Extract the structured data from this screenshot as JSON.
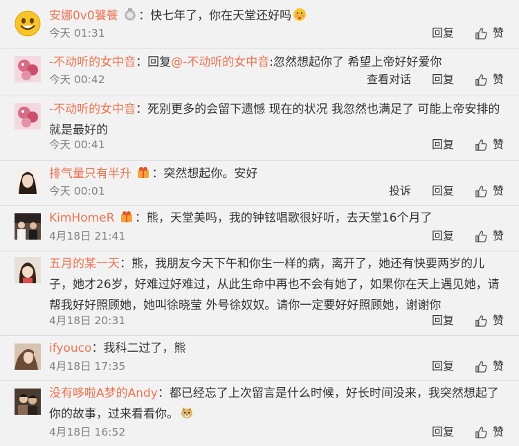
{
  "comments": [
    {
      "avatar": "yellow-smiley-avatar",
      "name": "安娜0v0饕餮",
      "badge": "medal-icon",
      "text": "：快七年了，你在天堂还好吗",
      "emoji": "blush-emoji",
      "time": "今天 01:31",
      "actions": [
        "回复",
        "赞"
      ]
    },
    {
      "avatar": "pink-cartoon-avatar",
      "name": "-不动听的女中音",
      "text_prefix": "：回复",
      "mention": "@-不动听的女中音",
      "text": ":忽然想起你了 希望上帝好好爱你",
      "time": "今天 00:42",
      "actions": [
        "查看对话",
        "回复",
        "赞"
      ]
    },
    {
      "avatar": "pink-cartoon-avatar",
      "name": "-不动听的女中音",
      "text": "：死别更多的会留下遗憾 现在的状况 我忽然也满足了 可能上帝安排的就是最好的",
      "time": "今天 00:41",
      "actions": [
        "回复",
        "赞"
      ]
    },
    {
      "avatar": "woman-photo-avatar",
      "name": "排气量只有半升",
      "badge": "gift-badge-icon",
      "text": "：突然想起你。安好",
      "time": "今天 00:01",
      "actions": [
        "投诉",
        "回复",
        "赞"
      ]
    },
    {
      "avatar": "group-photo-avatar",
      "name": "KimHomeR",
      "badge": "gift-badge-icon",
      "text": "：熊，天堂美吗，我的钟铉唱歌很好听，去天堂16个月了",
      "time": "4月18日 21:41",
      "actions": [
        "回复",
        "赞"
      ]
    },
    {
      "avatar": "anime-girl-avatar",
      "name": "五月的某一天",
      "text": "：熊，我朋友今天下午和你生一样的病，离开了，她还有快要两岁的儿子，她才26岁，好难过好难过，从此生命中再也不会有她了，如果你在天上遇见她，请帮我好好照顾她，她叫徐晓莹 外号徐奴奴。请你一定要好好照顾她，谢谢你",
      "time": "4月18日 20:31",
      "actions": [
        "回复",
        "赞"
      ]
    },
    {
      "avatar": "portrait-photo-avatar",
      "name": "ifyouco",
      "text": "：我科二过了，熊",
      "time": "4月18日 17:35",
      "actions": [
        "回复",
        "赞"
      ]
    },
    {
      "avatar": "couple-photo-avatar",
      "name": "没有哆啦A梦的Andy",
      "text": "：都已经忘了上次留言是什么时候，好长时间没来，我突然想起了你的故事，过来看看你。",
      "emoji": "doge-emoji",
      "time": "4月18日 16:52",
      "actions": [
        "回复",
        "赞"
      ]
    }
  ],
  "colors": {
    "name": "#eb7350",
    "text": "#333333",
    "meta": "#808080",
    "background": "#f2f2f2",
    "divider": "#dcdcdc"
  }
}
